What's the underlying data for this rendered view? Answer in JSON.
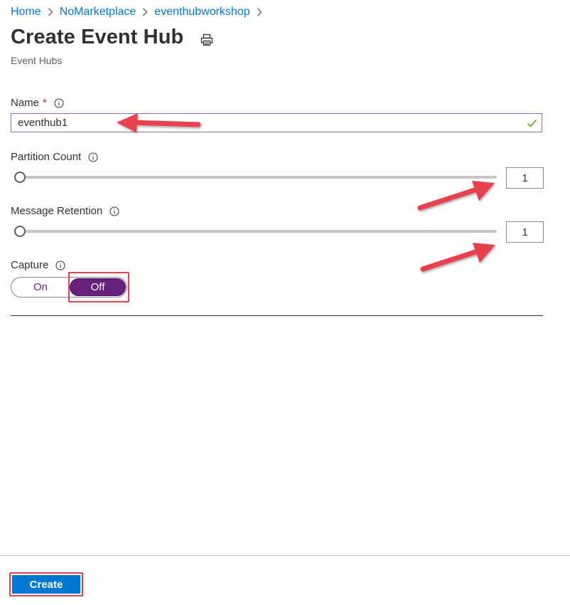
{
  "breadcrumb": [
    {
      "label": "Home"
    },
    {
      "label": "NoMarketplace"
    },
    {
      "label": "eventhubworkshop"
    }
  ],
  "page": {
    "title": "Create Event Hub",
    "subtitle": "Event Hubs"
  },
  "form": {
    "name": {
      "label": "Name",
      "required_mark": "*",
      "value": "eventhub1",
      "valid": true
    },
    "partition_count": {
      "label": "Partition Count",
      "value": "1",
      "slider_fraction": 0
    },
    "message_retention": {
      "label": "Message Retention",
      "value": "1",
      "slider_fraction": 0
    },
    "capture": {
      "label": "Capture",
      "on_label": "On",
      "off_label": "Off",
      "selected": "Off"
    }
  },
  "footer": {
    "create_label": "Create"
  },
  "icons": {
    "chevron": "chevron-right-icon",
    "print": "print-icon",
    "info": "info-icon",
    "valid": "checkmark-icon",
    "annotation": "red-arrow"
  },
  "colors": {
    "link": "#0078d4",
    "accent": "#68217a",
    "primary_button": "#0078d4",
    "highlight": "#e8414e",
    "valid_check": "#57a300"
  }
}
